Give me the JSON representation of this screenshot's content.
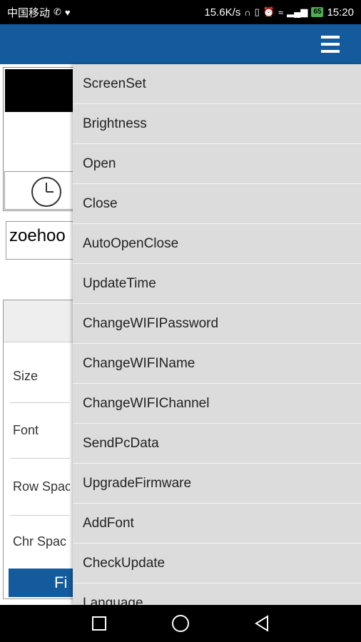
{
  "status_bar": {
    "carrier": "中国移动",
    "speed": "15.6K/s",
    "battery": "65",
    "time": "15:20"
  },
  "content": {
    "text_value": "zoehoo",
    "rows": [
      "Size",
      "Font",
      "Row Spac",
      "Chr Spac"
    ],
    "finish_label": "Fi"
  },
  "menu": {
    "items": [
      "ScreenSet",
      "Brightness",
      "Open",
      "Close",
      "AutoOpenClose",
      "UpdateTime",
      "ChangeWIFIPassword",
      "ChangeWIFIName",
      "ChangeWIFIChannel",
      "SendPcData",
      "UpgradeFirmware",
      "AddFont",
      "CheckUpdate",
      "Language"
    ]
  },
  "colors": {
    "app_bar": "#135b9c",
    "menu_background": "#dcdcdc"
  }
}
